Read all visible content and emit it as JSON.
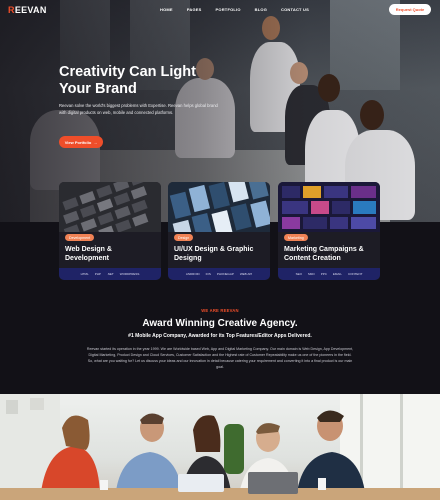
{
  "header": {
    "logo_mark": "R",
    "logo_rest": "EEVAN",
    "nav": [
      "HOME",
      "PAGES",
      "PORTFOLIO",
      "BLOG",
      "CONTACT US"
    ],
    "request_button": "Request Quote"
  },
  "hero": {
    "title_line1": "Creativity Can Light",
    "title_line2": "Your Brand",
    "description": "Reevan solve the world's biggest problems with Expertise. Reevan helps global brand with digital products on web, mobile and connected platforms.",
    "cta_label": "View Portfolio",
    "cta_arrow": "→"
  },
  "services": [
    {
      "tag": "Development",
      "title_line1": "Web Design &",
      "title_line2": "Development",
      "techs": [
        "HTML",
        "PHP",
        ".NET",
        "WORDPRESS"
      ]
    },
    {
      "tag": "Design",
      "title_line1": "UI/UX Design & Graphic",
      "title_line2": "Designg",
      "techs": [
        "ANDROID",
        "IOS",
        "PHONEGAP",
        "WEB API"
      ]
    },
    {
      "tag": "Marketing",
      "title_line1": "Marketing Campaigns &",
      "title_line2": "Content Creation",
      "techs": [
        "SEO",
        "SMO",
        "PPC",
        "EMAIL",
        "CONTENT"
      ]
    }
  ],
  "about": {
    "kicker": "WE ARE REEVAN",
    "title": "Award Winning Creative Agency.",
    "subtitle": "#1 Mobile App Company, Awarded for its Top Features/Editor Apps Delivered.",
    "body": "Reevan started its operation in the year 1999. We are Worldwide based Web, App and Digital Marketing Company. Our main domain is Web Design, App Development, Digital Marketing, Product Design and Cloud Services, Customer Satisfaction and the Highest rate of Customer Repeatability make us one of the pioneers in the field. So, what are you waiting for? Let us discuss your ideas and our innovation in detail because catering your requirement and converting it into a final product is our main goal."
  },
  "colors": {
    "accent": "#ef4e2a",
    "background": "#121117",
    "card": "#1d1c25",
    "tech_bar": "#1f2366"
  }
}
